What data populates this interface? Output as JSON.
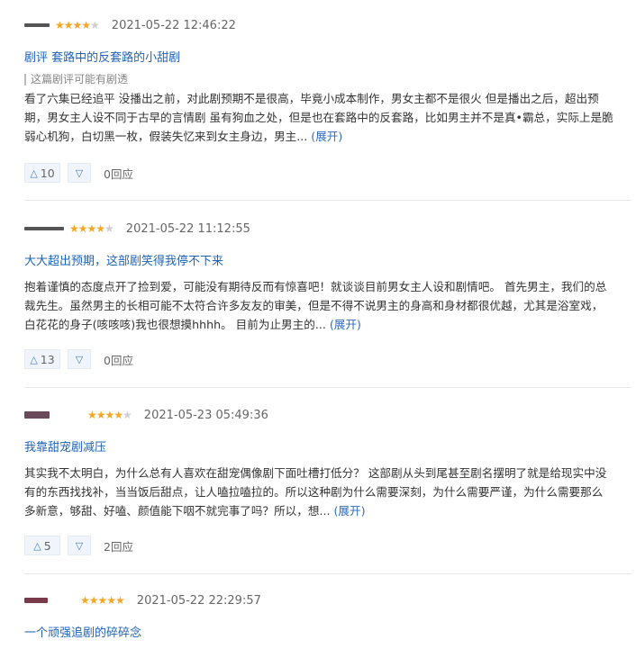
{
  "reviews": [
    {
      "stars": "★★★★",
      "stars_off": "★",
      "date": "2021-05-22 12:46:22",
      "title": "剧评 套路中的反套路的小甜剧",
      "spoiler": "这篇剧评可能有剧透",
      "lines": [
        "看了六集已经追平 没播出之前，对此剧预期不是很高，毕竟小成本制作，男女主都不是很火 但是播出之后，超出预",
        "期，男女主人设不同于古早的言情剧 虽有狗血之处，但是也在套路中的反套路，比如男主并不是真•霸总，实际上是脆",
        "弱心机狗，白切黑一枚，假装失忆来到女主身边，男主..."
      ],
      "expand": "(展开)",
      "up_icon": "△",
      "likes": "10",
      "down_icon": "▽",
      "replies": "0回应"
    },
    {
      "stars": "★★★★",
      "stars_off": "★",
      "date": "2021-05-22 11:12:55",
      "title": "大大超出预期，这部剧笑得我停不下来",
      "lines": [
        "抱着谨慎的态度点开了捡到爱，可能没有期待反而有惊喜吧！就谈谈目前男女主人设和剧情吧。 首先男主，我们的总",
        "裁先生。虽然男主的长相可能不太符合许多友友的审美，但是不得不说男主的身高和身材都很优越，尤其是浴室戏，",
        "白花花的身子(咳咳咳)我也很想摸hhhh。 目前为止男主的..."
      ],
      "expand": "(展开)",
      "up_icon": "△",
      "likes": "13",
      "down_icon": "▽",
      "replies": "0回应"
    },
    {
      "stars": "★★★★",
      "stars_off": "★",
      "date": "2021-05-23 05:49:36",
      "title": "我靠甜宠剧减压",
      "lines": [
        "其实我不太明白，为什么总有人喜欢在甜宠偶像剧下面吐槽打低分？ 这部剧从头到尾甚至剧名摆明了就是给现实中没",
        "有的东西找找补，当当饭后甜点，让人嗑拉嗑拉的。所以这种剧为什么需要深刻，为什么需要严谨，为什么需要那么",
        "多新意，够甜、好嗑、颜值能下咽不就完事了吗？所以，想..."
      ],
      "expand": "(展开)",
      "up_icon": "△",
      "likes": "5",
      "down_icon": "▽",
      "replies": "2回应"
    },
    {
      "stars": "★★★★★",
      "date": "2021-05-22 22:29:57",
      "title": "一个顽强追剧的碎碎念"
    }
  ]
}
